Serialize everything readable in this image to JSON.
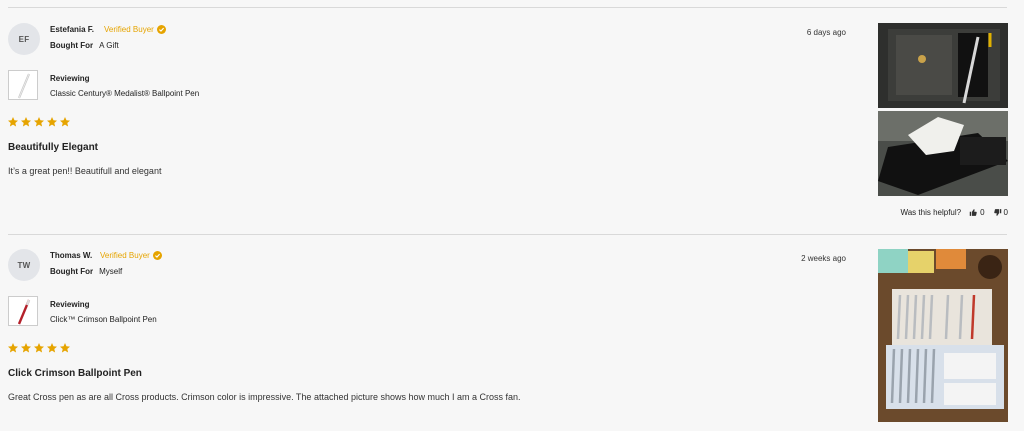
{
  "reviews": [
    {
      "initials": "EF",
      "author": "Estefania F.",
      "verified_label": "Verified Buyer",
      "bought_for_label": "Bought For",
      "bought_for_value": "A Gift",
      "date": "6 days ago",
      "reviewing_label": "Reviewing",
      "product": "Classic Century® Medalist® Ballpoint Pen",
      "rating": 5,
      "title": "Beautifully Elegant",
      "body": "It’s a great pen!! Beautifull and elegant",
      "helpful_label": "Was this helpful?",
      "up_votes": "0",
      "down_votes": "0"
    },
    {
      "initials": "TW",
      "author": "Thomas W.",
      "verified_label": "Verified Buyer",
      "bought_for_label": "Bought For",
      "bought_for_value": "Myself",
      "date": "2 weeks ago",
      "reviewing_label": "Reviewing",
      "product": "Click™ Crimson Ballpoint Pen",
      "rating": 5,
      "title": "Click Crimson Ballpoint Pen",
      "body": "Great Cross pen as are all Cross products. Crimson color is impressive. The attached picture shows how much I am a Cross fan."
    }
  ],
  "colors": {
    "accent": "#e6a400",
    "divider": "#d9d9d9",
    "background": "#f7f7f7"
  },
  "icons": {
    "verified": "check-badge-icon",
    "star": "star-icon",
    "thumbs_up": "thumbs-up-icon",
    "thumbs_down": "thumbs-down-icon"
  }
}
